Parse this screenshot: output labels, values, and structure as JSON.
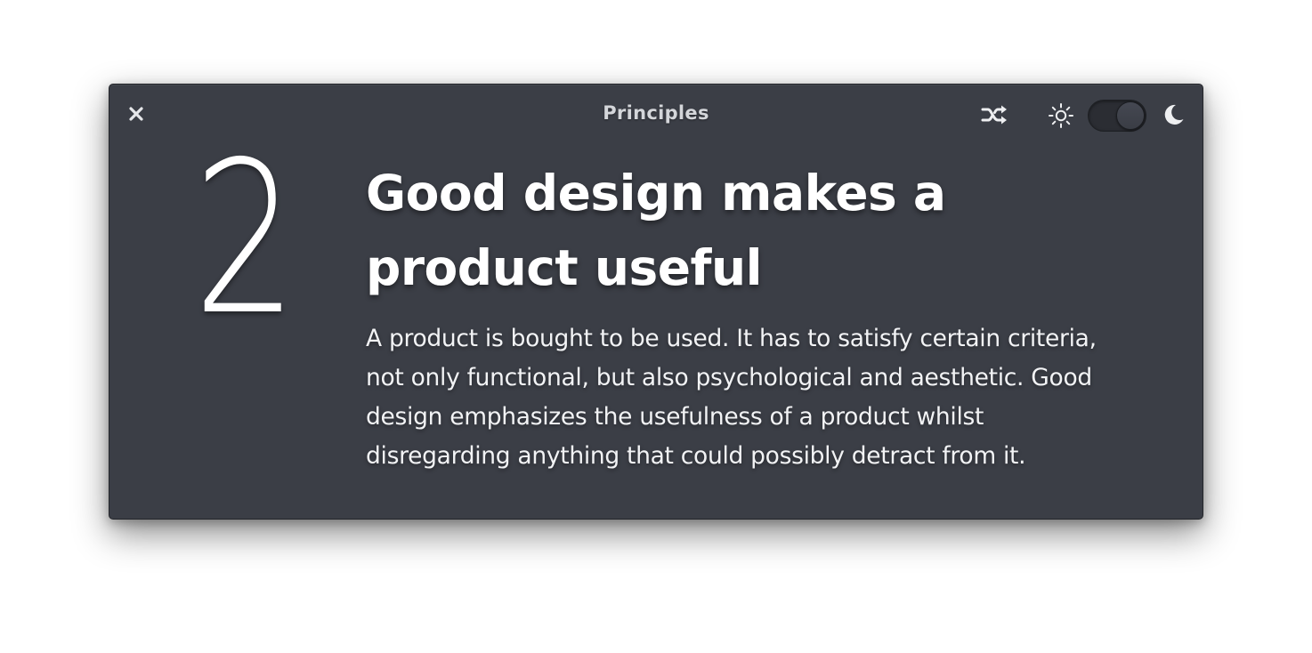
{
  "window": {
    "title": "Principles"
  },
  "header": {
    "close_icon": "close-icon",
    "shuffle_icon": "shuffle-icon",
    "light_icon": "sun-icon",
    "dark_icon": "moon-icon",
    "dark_mode_enabled": true
  },
  "principle": {
    "number": "2",
    "heading_line1": "Good design makes a",
    "heading_line2": "product useful",
    "body_lines": [
      "A product is bought to be used. It has to satisfy certain criteria,",
      "not only functional, but also psychological and aesthetic. Good",
      "design emphasizes the usefulness of a product whilst",
      "disregarding anything that could possibly detract from it."
    ]
  },
  "colors": {
    "window_background": "#3b3e46",
    "text": "#ffffff",
    "title_text": "#d4d6da"
  }
}
